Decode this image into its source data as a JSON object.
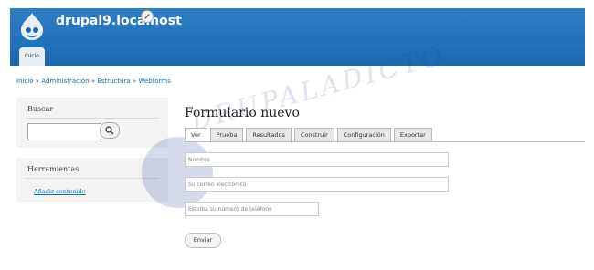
{
  "header": {
    "site_name": "drupal9.localhost",
    "home_tab": "Inicio"
  },
  "breadcrumb": [
    "Inicio",
    "Administración",
    "Estructura",
    "Webforms"
  ],
  "search_block": {
    "title": "Buscar",
    "input_value": ""
  },
  "tools_block": {
    "title": "Herramientas",
    "link": "Añadir contenido"
  },
  "page": {
    "title": "Formulario nuevo",
    "tabs": [
      "Ver",
      "Prueba",
      "Resultados",
      "Construir",
      "Configuración",
      "Exportar"
    ],
    "fields": [
      "Nombre",
      "Su correo electrónico",
      "Escriba su número de teléfono"
    ],
    "submit_label": "Enviar"
  },
  "watermark": {
    "text": "DRUPALADICTO"
  },
  "colors": {
    "header": "#1b68b0",
    "link": "#0074bd"
  }
}
